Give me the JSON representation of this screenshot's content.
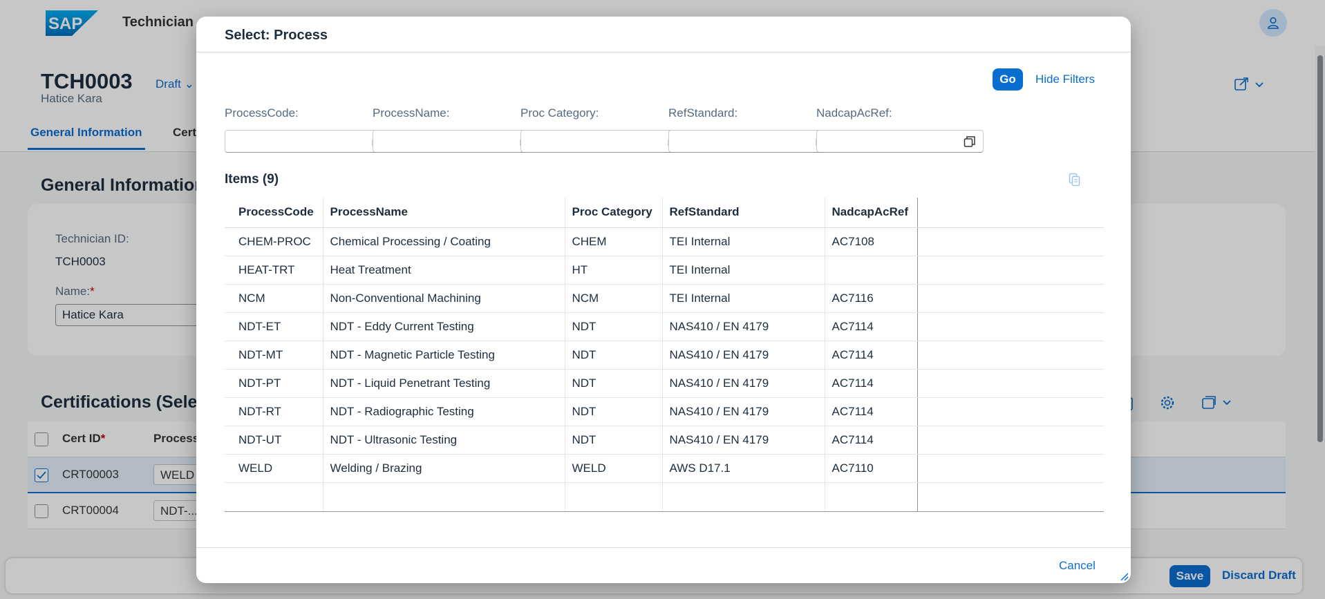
{
  "shell": {
    "logo": "SAP",
    "title": "Technician",
    "avatar_icon": "user-icon"
  },
  "object_header": {
    "title": "TCH0003",
    "subtitle": "Hatice Kara",
    "draft_label": "Draft",
    "tabs": [
      {
        "label": "General Information"
      },
      {
        "label": "Cert"
      }
    ]
  },
  "general_section": {
    "title": "General Information",
    "technician_id_label": "Technician ID:",
    "technician_id_value": "TCH0003",
    "name_label": "Name:",
    "name_required": "*",
    "name_value": "Hatice Kara"
  },
  "certifications": {
    "title": "Certifications (Selec",
    "columns": {
      "cert_id": "Cert ID",
      "required": "*",
      "process": "Process"
    },
    "rows": [
      {
        "cert_id": "CRT00003",
        "process": "WELD",
        "selected": true
      },
      {
        "cert_id": "CRT00004",
        "process": "NDT-...",
        "selected": false
      }
    ]
  },
  "footer": {
    "save": "Save",
    "discard": "Discard Draft"
  },
  "dialog": {
    "title": "Select: Process",
    "go_label": "Go",
    "hide_filters_label": "Hide Filters",
    "filters": [
      {
        "label": "ProcessCode:",
        "value": ""
      },
      {
        "label": "ProcessName:",
        "value": ""
      },
      {
        "label": "Proc Category:",
        "value": ""
      },
      {
        "label": "RefStandard:",
        "value": ""
      },
      {
        "label": "NadcapAcRef:",
        "value": ""
      }
    ],
    "items_title": "Items (9)",
    "columns": [
      "ProcessCode",
      "ProcessName",
      "Proc Category",
      "RefStandard",
      "NadcapAcRef"
    ],
    "rows": [
      [
        "CHEM-PROC",
        "Chemical Processing / Coating",
        "CHEM",
        "TEI Internal",
        "AC7108"
      ],
      [
        "HEAT-TRT",
        "Heat Treatment",
        "HT",
        "TEI Internal",
        ""
      ],
      [
        "NCM",
        "Non-Conventional Machining",
        "NCM",
        "TEI Internal",
        "AC7116"
      ],
      [
        "NDT-ET",
        "NDT - Eddy Current Testing",
        "NDT",
        "NAS410 / EN 4179",
        "AC7114"
      ],
      [
        "NDT-MT",
        "NDT - Magnetic Particle Testing",
        "NDT",
        "NAS410 / EN 4179",
        "AC7114"
      ],
      [
        "NDT-PT",
        "NDT - Liquid Penetrant Testing",
        "NDT",
        "NAS410 / EN 4179",
        "AC7114"
      ],
      [
        "NDT-RT",
        "NDT - Radiographic Testing",
        "NDT",
        "NAS410 / EN 4179",
        "AC7114"
      ],
      [
        "NDT-UT",
        "NDT - Ultrasonic Testing",
        "NDT",
        "NAS410 / EN 4179",
        "AC7114"
      ],
      [
        "WELD",
        "Welding / Brazing",
        "WELD",
        "AWS D17.1",
        "AC7110"
      ]
    ],
    "cancel_label": "Cancel"
  },
  "colors": {
    "accent": "#0a6ed1",
    "text": "#1d2d3e",
    "label": "#556b82"
  }
}
